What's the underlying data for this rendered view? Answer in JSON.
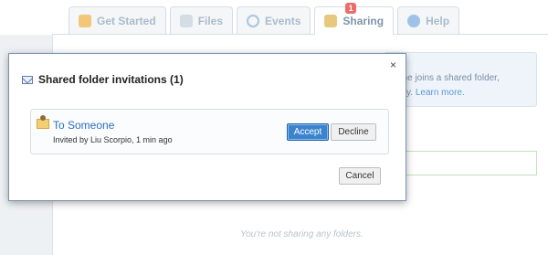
{
  "tabs": [
    {
      "label": "Get Started",
      "icon": "rocket-icon"
    },
    {
      "label": "Files",
      "icon": "files-icon"
    },
    {
      "label": "Events",
      "icon": "clock-icon"
    },
    {
      "label": "Sharing",
      "icon": "sharing-icon",
      "badge": "1",
      "active": true
    },
    {
      "label": "Help",
      "icon": "help-icon"
    }
  ],
  "info_box": {
    "line1": "one joins a shared folder,",
    "line2": "ally.",
    "link": "Learn more."
  },
  "empty_text": "You're not sharing any folders.",
  "modal": {
    "title": "Shared folder invitations (1)",
    "close": "×",
    "invitation": {
      "folder_name": "To Someone",
      "invited_by": "Invited by Liu Scorpio, 1 min ago",
      "accept_label": "Accept",
      "decline_label": "Decline"
    },
    "cancel_label": "Cancel"
  },
  "colors": {
    "accent": "#3a84cf",
    "link": "#2a6fc0",
    "badge": "#ee6b6b"
  }
}
